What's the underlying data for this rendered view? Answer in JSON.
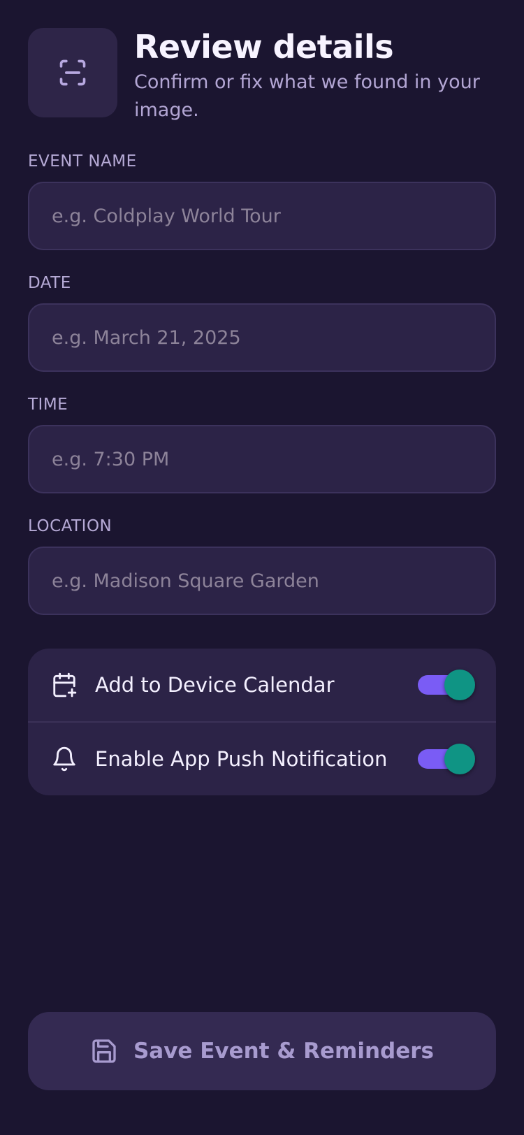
{
  "header": {
    "title": "Review details",
    "subtitle": "Confirm or fix what we found in your image.",
    "icon": "scan-icon"
  },
  "fields": [
    {
      "label": "EVENT NAME",
      "value": "",
      "placeholder": "e.g. Coldplay World Tour"
    },
    {
      "label": "DATE",
      "value": "",
      "placeholder": "e.g. March 21, 2025"
    },
    {
      "label": "TIME",
      "value": "",
      "placeholder": "e.g. 7:30 PM"
    },
    {
      "label": "LOCATION",
      "value": "",
      "placeholder": "e.g. Madison Square Garden"
    }
  ],
  "toggles": [
    {
      "label": "Add to Device Calendar",
      "icon": "calendar-plus-icon",
      "on": true
    },
    {
      "label": "Enable App Push Notification",
      "icon": "bell-icon",
      "on": true
    }
  ],
  "save_button": {
    "label": "Save Event & Reminders",
    "icon": "save-icon"
  },
  "colors": {
    "background": "#1b1530",
    "surface": "#2c2347",
    "accent": "#7a5cf5",
    "knob": "#0f9484",
    "muted_text": "#b3a6d4"
  }
}
